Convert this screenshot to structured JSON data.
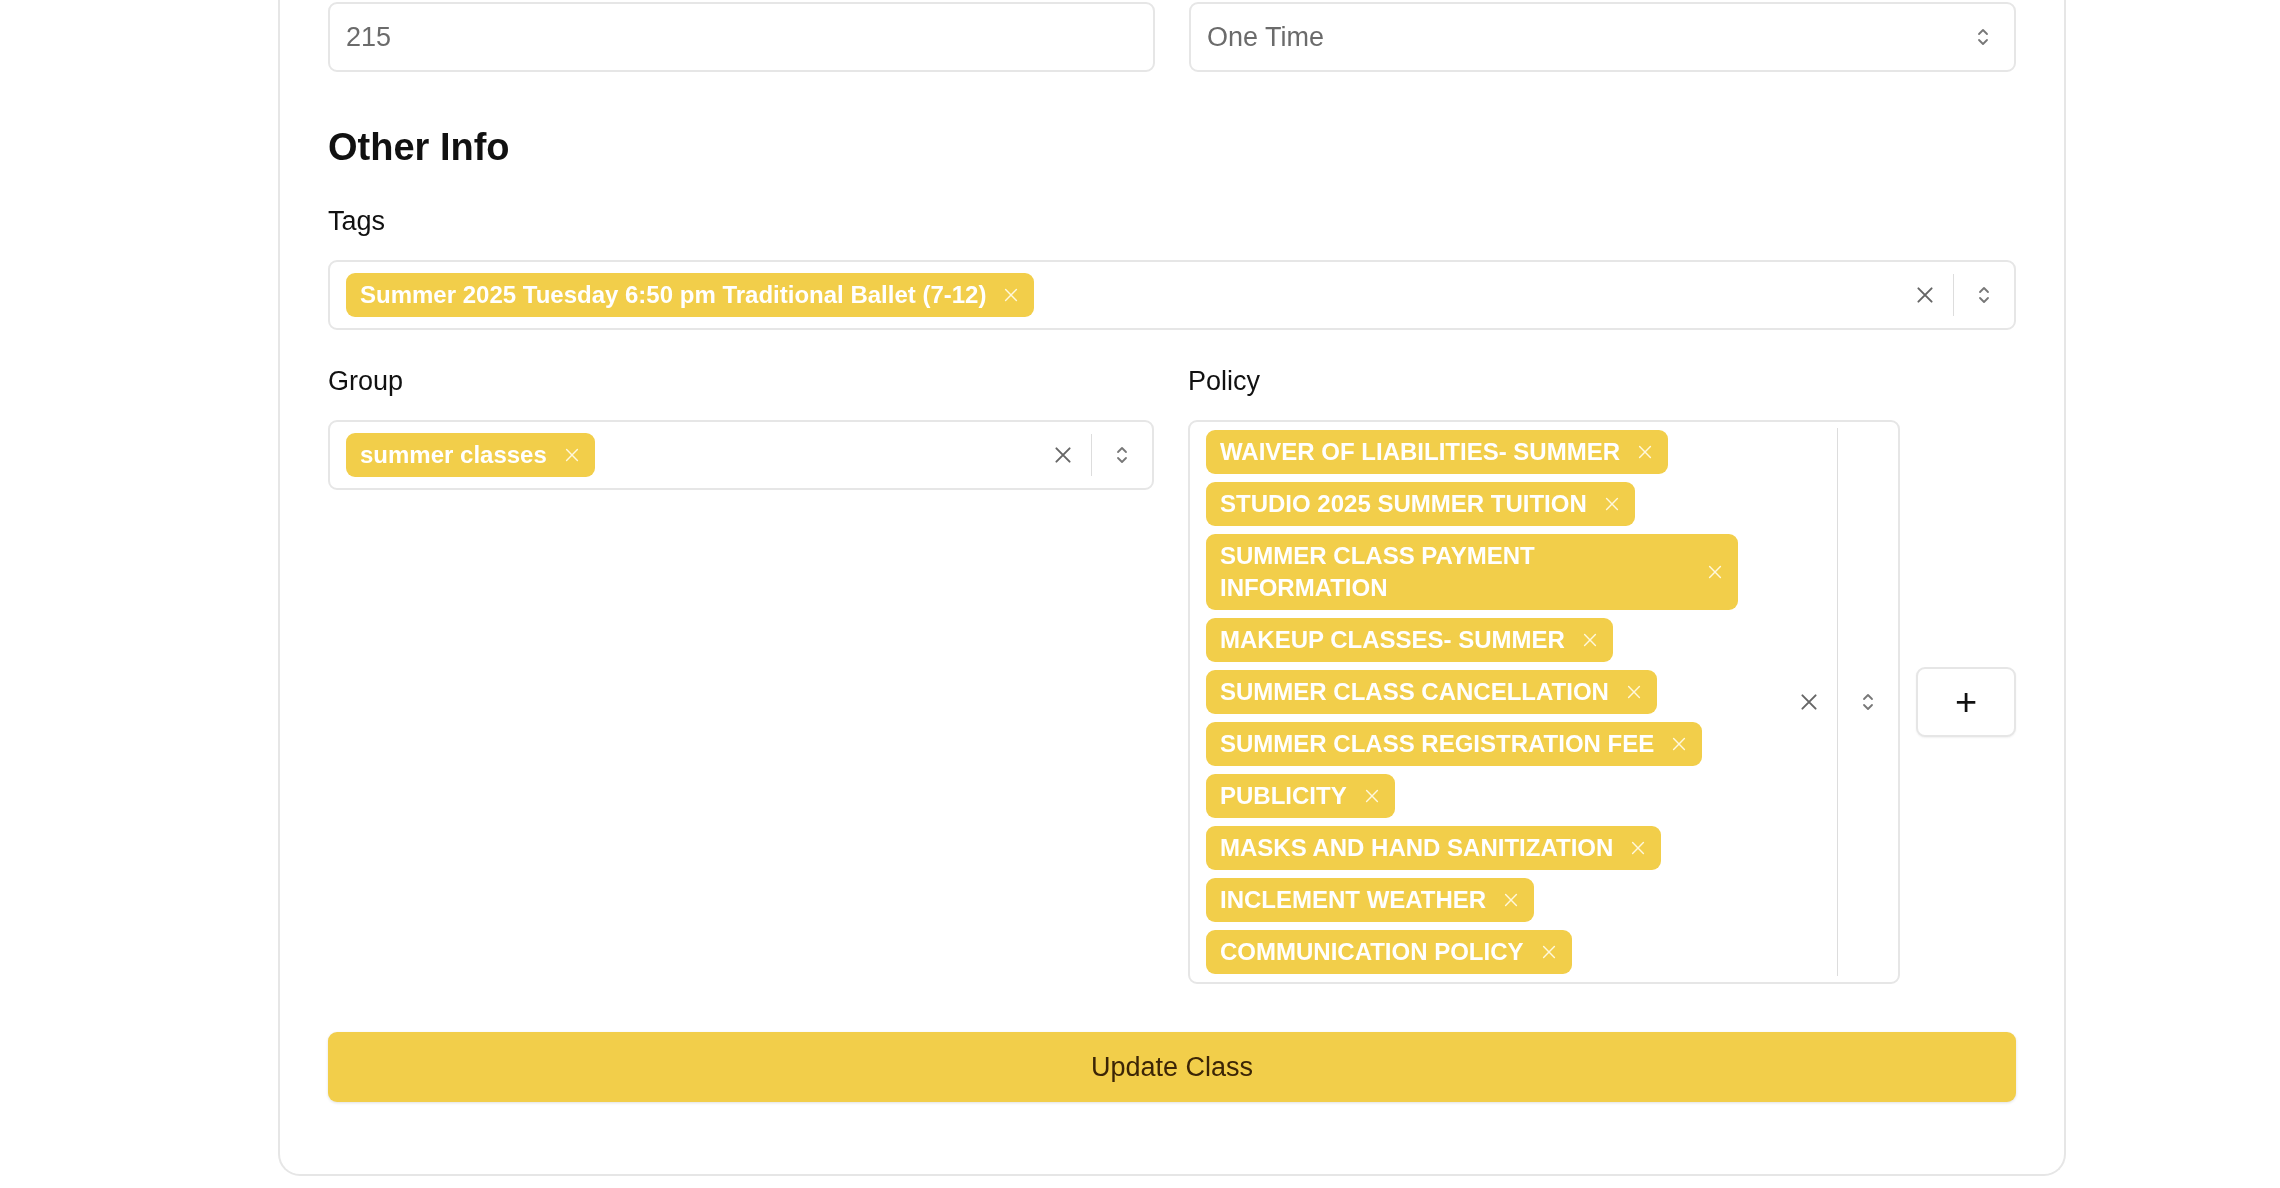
{
  "fields": [
    {
      "kind": "text",
      "value": "215"
    },
    {
      "kind": "select",
      "value": "One Time"
    }
  ],
  "section_title": "Other Info",
  "tags": {
    "label": "Tags",
    "chips": [
      "Summer 2025 Tuesday 6:50 pm Traditional Ballet (7-12)"
    ]
  },
  "group": {
    "label": "Group",
    "chips": [
      "summer classes"
    ]
  },
  "policy": {
    "label": "Policy",
    "chips": [
      "WAIVER OF LIABILITIES- SUMMER",
      "STUDIO 2025 SUMMER TUITION",
      "SUMMER CLASS PAYMENT INFORMATION",
      "MAKEUP CLASSES- SUMMER",
      "SUMMER CLASS CANCELLATION",
      "SUMMER CLASS REGISTRATION FEE",
      "PUBLICITY",
      "MASKS AND HAND SANITIZATION",
      "INCLEMENT WEATHER",
      "COMMUNICATION POLICY"
    ]
  },
  "add_button": "+",
  "submit": "Update Class"
}
